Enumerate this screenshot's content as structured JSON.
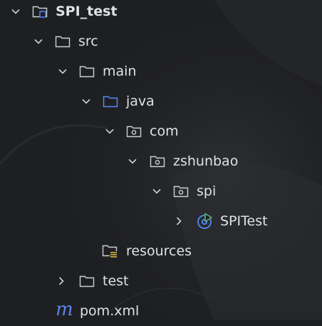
{
  "tree": {
    "project": {
      "label": "SPI_test",
      "icon": "project-folder-icon"
    },
    "src": {
      "label": "src",
      "icon": "folder-icon"
    },
    "main": {
      "label": "main",
      "icon": "folder-icon"
    },
    "java": {
      "label": "java",
      "icon": "source-root-folder-icon"
    },
    "com": {
      "label": "com",
      "icon": "package-icon"
    },
    "zshunbao": {
      "label": "zshunbao",
      "icon": "package-icon"
    },
    "spi": {
      "label": "spi",
      "icon": "package-icon"
    },
    "spitest": {
      "label": "SPITest",
      "icon": "test-class-icon"
    },
    "resources": {
      "label": "resources",
      "icon": "resources-folder-icon"
    },
    "test": {
      "label": "test",
      "icon": "folder-icon"
    },
    "pom": {
      "label": "pom.xml",
      "icon": "maven-icon"
    }
  },
  "colors": {
    "background": "#1e1f22",
    "text": "#dfe1e5",
    "icon_gray": "#ced0d6",
    "source_root_blue": "#548af7",
    "maven_blue": "#5b84e8",
    "resources_yellow": "#e0b440"
  }
}
